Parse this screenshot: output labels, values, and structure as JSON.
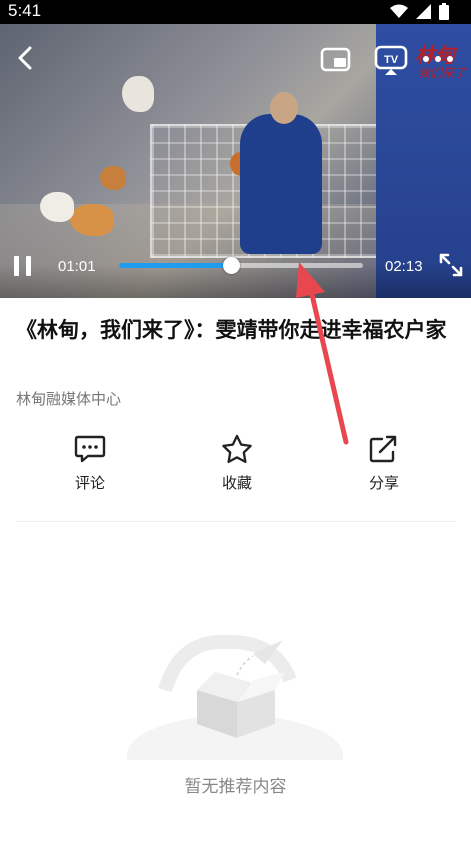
{
  "status_bar": {
    "time": "5:41"
  },
  "player": {
    "current_time": "01:01",
    "total_time": "02:13",
    "progress_fraction": 0.46,
    "watermark_logo": {
      "line1": "林甸",
      "line2": "我们来了"
    }
  },
  "article": {
    "title": "《林甸，我们来了》：雯靖带你走进幸福农户家",
    "source": "林甸融媒体中心"
  },
  "actions": [
    {
      "label": "评论",
      "icon": "comment-icon"
    },
    {
      "label": "收藏",
      "icon": "star-icon"
    },
    {
      "label": "分享",
      "icon": "share-icon"
    }
  ],
  "recommend": {
    "empty_text": "暂无推荐内容"
  },
  "colors": {
    "accent": "#1e9cf0",
    "annotation_arrow": "#e9474f"
  }
}
